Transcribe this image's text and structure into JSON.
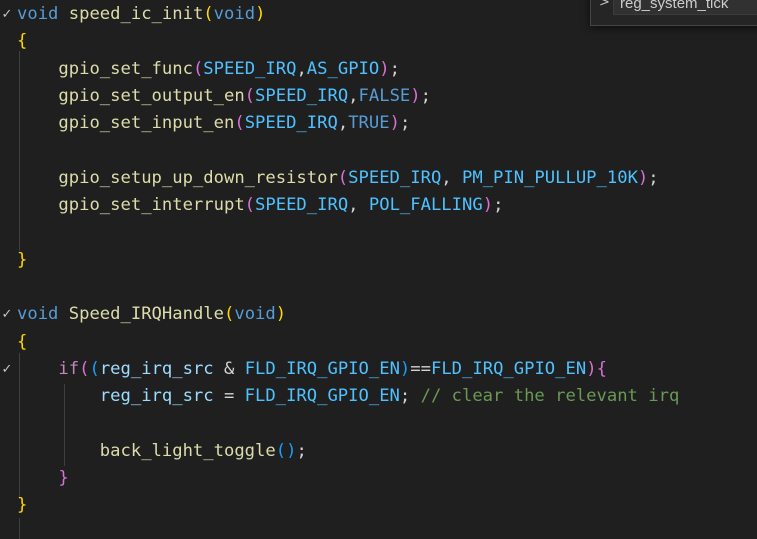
{
  "find_widget": {
    "value": "reg_system_tick"
  },
  "lines": [
    {
      "fold": "✓",
      "tokens": [
        {
          "t": "void",
          "c": "kw"
        },
        {
          "t": " ",
          "c": "pl"
        },
        {
          "t": "speed_ic_init",
          "c": "fn"
        },
        {
          "t": "(",
          "c": "b1"
        },
        {
          "t": "void",
          "c": "kw"
        },
        {
          "t": ")",
          "c": "b1"
        }
      ]
    },
    {
      "fold": "",
      "tokens": [
        {
          "t": "{",
          "c": "b1"
        }
      ]
    },
    {
      "fold": "",
      "tokens": [
        {
          "t": "    ",
          "c": "pl"
        },
        {
          "t": "gpio_set_func",
          "c": "fn"
        },
        {
          "t": "(",
          "c": "b2"
        },
        {
          "t": "SPEED_IRQ",
          "c": "mac"
        },
        {
          "t": ",",
          "c": "pl"
        },
        {
          "t": "AS_GPIO",
          "c": "mac"
        },
        {
          "t": ")",
          "c": "b2"
        },
        {
          "t": ";",
          "c": "pl"
        }
      ]
    },
    {
      "fold": "",
      "tokens": [
        {
          "t": "    ",
          "c": "pl"
        },
        {
          "t": "gpio_set_output_en",
          "c": "fn"
        },
        {
          "t": "(",
          "c": "b2"
        },
        {
          "t": "SPEED_IRQ",
          "c": "mac"
        },
        {
          "t": ",",
          "c": "pl"
        },
        {
          "t": "FALSE",
          "c": "kw"
        },
        {
          "t": ")",
          "c": "b2"
        },
        {
          "t": ";",
          "c": "pl"
        }
      ]
    },
    {
      "fold": "",
      "tokens": [
        {
          "t": "    ",
          "c": "pl"
        },
        {
          "t": "gpio_set_input_en",
          "c": "fn"
        },
        {
          "t": "(",
          "c": "b2"
        },
        {
          "t": "SPEED_IRQ",
          "c": "mac"
        },
        {
          "t": ",",
          "c": "pl"
        },
        {
          "t": "TRUE",
          "c": "kw"
        },
        {
          "t": ")",
          "c": "b2"
        },
        {
          "t": ";",
          "c": "pl"
        }
      ]
    },
    {
      "fold": "",
      "tokens": []
    },
    {
      "fold": "",
      "tokens": [
        {
          "t": "    ",
          "c": "pl"
        },
        {
          "t": "gpio_setup_up_down_resistor",
          "c": "fn"
        },
        {
          "t": "(",
          "c": "b2"
        },
        {
          "t": "SPEED_IRQ",
          "c": "mac"
        },
        {
          "t": ", ",
          "c": "pl"
        },
        {
          "t": "PM_PIN_PULLUP_10K",
          "c": "mac"
        },
        {
          "t": ")",
          "c": "b2"
        },
        {
          "t": ";",
          "c": "pl"
        }
      ]
    },
    {
      "fold": "",
      "tokens": [
        {
          "t": "    ",
          "c": "pl"
        },
        {
          "t": "gpio_set_interrupt",
          "c": "fn"
        },
        {
          "t": "(",
          "c": "b2"
        },
        {
          "t": "SPEED_IRQ",
          "c": "mac"
        },
        {
          "t": ", ",
          "c": "pl"
        },
        {
          "t": "POL_FALLING",
          "c": "mac"
        },
        {
          "t": ")",
          "c": "b2"
        },
        {
          "t": ";",
          "c": "pl"
        }
      ]
    },
    {
      "fold": "",
      "tokens": []
    },
    {
      "fold": "",
      "tokens": [
        {
          "t": "}",
          "c": "b1"
        }
      ]
    },
    {
      "fold": "",
      "tokens": []
    },
    {
      "fold": "✓",
      "tokens": [
        {
          "t": "void",
          "c": "kw"
        },
        {
          "t": " ",
          "c": "pl"
        },
        {
          "t": "Speed_IRQHandle",
          "c": "fn"
        },
        {
          "t": "(",
          "c": "b1"
        },
        {
          "t": "void",
          "c": "kw"
        },
        {
          "t": ")",
          "c": "b1"
        }
      ]
    },
    {
      "fold": "",
      "tokens": [
        {
          "t": "{",
          "c": "b1"
        }
      ]
    },
    {
      "fold": "✓",
      "tokens": [
        {
          "t": "    ",
          "c": "pl"
        },
        {
          "t": "if",
          "c": "ctl"
        },
        {
          "t": "(",
          "c": "b2"
        },
        {
          "t": "(",
          "c": "b3"
        },
        {
          "t": "reg_irq_src",
          "c": "id"
        },
        {
          "t": " & ",
          "c": "pl"
        },
        {
          "t": "FLD_IRQ_GPIO_EN",
          "c": "mac"
        },
        {
          "t": ")",
          "c": "b3"
        },
        {
          "t": "==",
          "c": "pl"
        },
        {
          "t": "FLD_IRQ_GPIO_EN",
          "c": "mac"
        },
        {
          "t": ")",
          "c": "b2"
        },
        {
          "t": "{",
          "c": "b2"
        }
      ]
    },
    {
      "fold": "",
      "tokens": [
        {
          "t": "        ",
          "c": "pl"
        },
        {
          "t": "reg_irq_src",
          "c": "id"
        },
        {
          "t": " = ",
          "c": "pl"
        },
        {
          "t": "FLD_IRQ_GPIO_EN",
          "c": "mac"
        },
        {
          "t": "; ",
          "c": "pl"
        },
        {
          "t": "// clear the relevant irq",
          "c": "cm"
        }
      ]
    },
    {
      "fold": "",
      "tokens": []
    },
    {
      "fold": "",
      "tokens": [
        {
          "t": "        ",
          "c": "pl"
        },
        {
          "t": "back_light_toggle",
          "c": "fn"
        },
        {
          "t": "(",
          "c": "b3"
        },
        {
          "t": ")",
          "c": "b3"
        },
        {
          "t": ";",
          "c": "pl"
        }
      ]
    },
    {
      "fold": "",
      "tokens": [
        {
          "t": "    ",
          "c": "pl"
        },
        {
          "t": "}",
          "c": "b2"
        }
      ]
    },
    {
      "fold": "",
      "tokens": [
        {
          "t": "}",
          "c": "b1"
        }
      ]
    }
  ]
}
